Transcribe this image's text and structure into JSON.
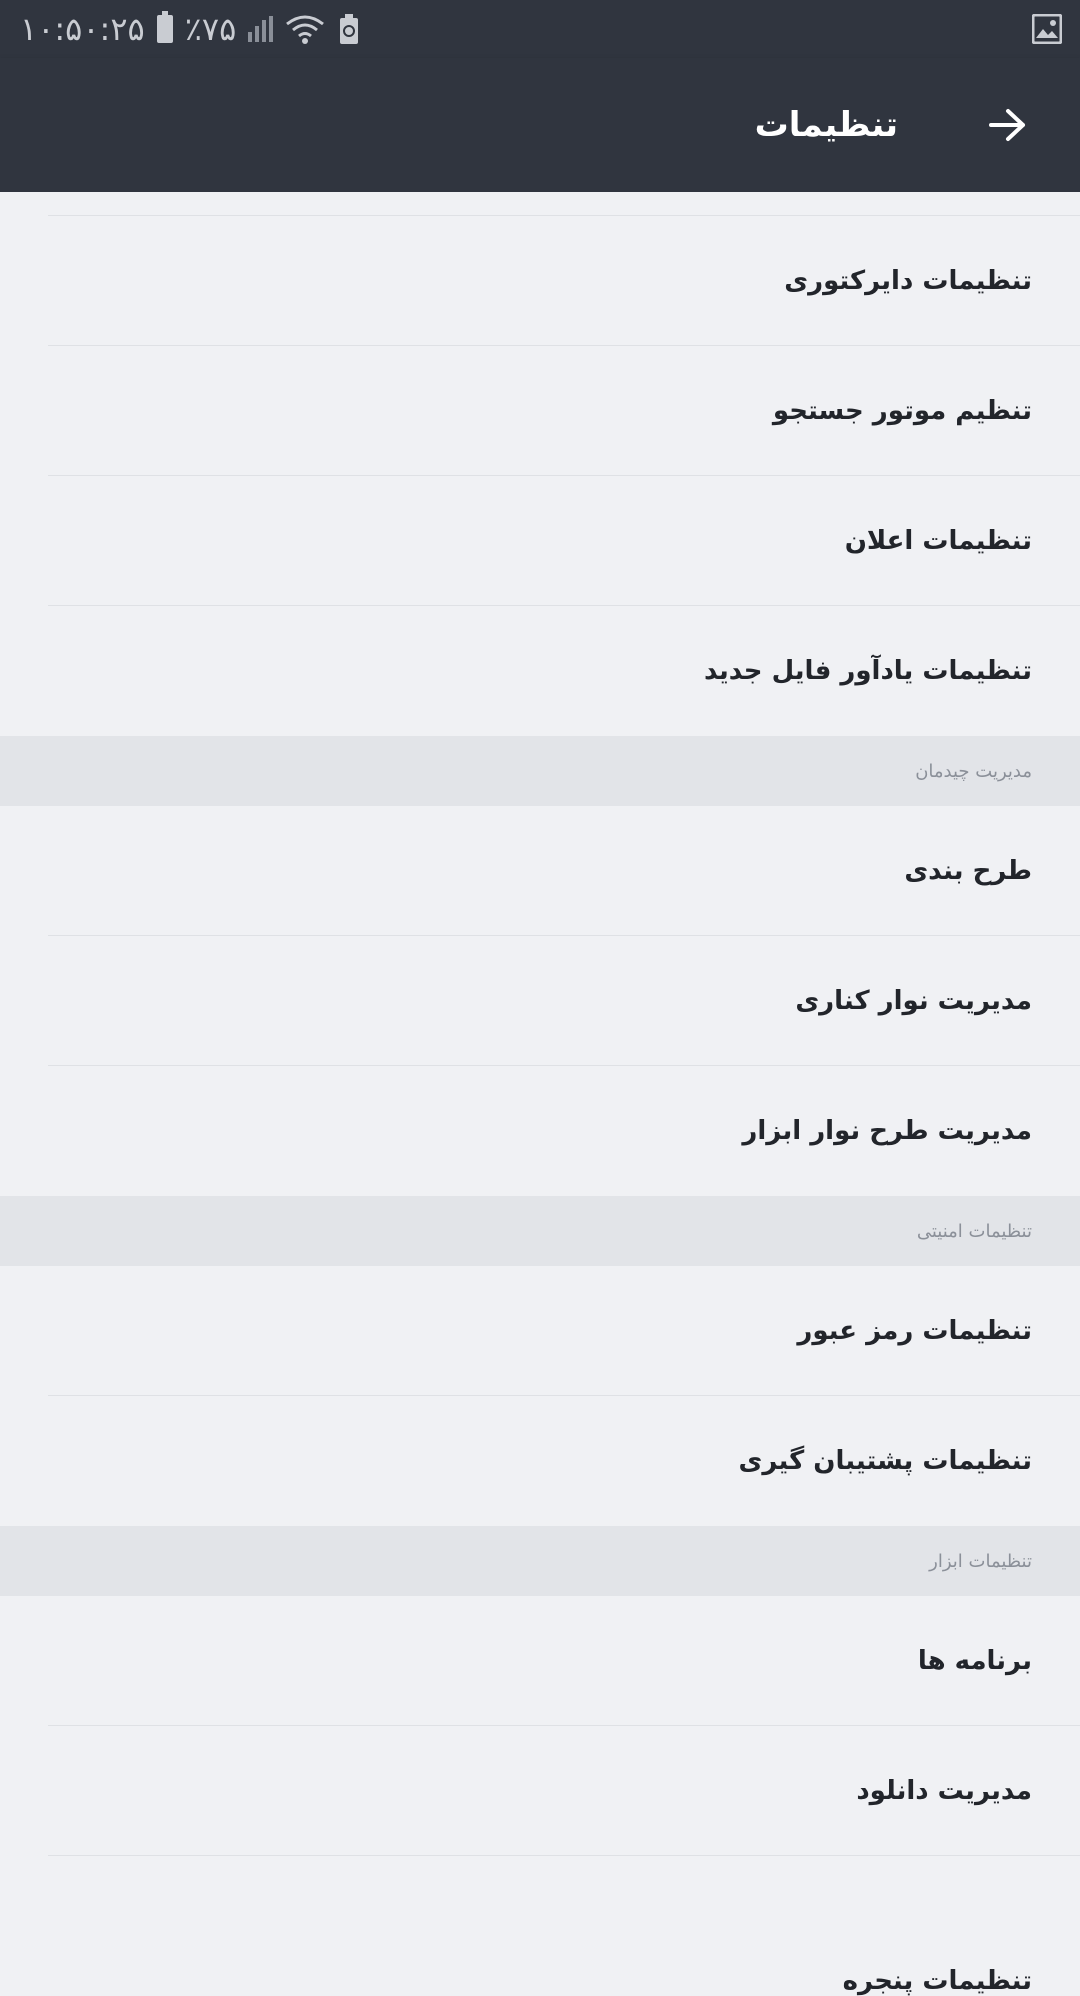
{
  "status_bar": {
    "clock": "۱۰:۵۰:۲۵",
    "battery": "٪۷۵"
  },
  "toolbar": {
    "title": "تنظیمات"
  },
  "items": {
    "directory": "تنظیمات دایرکتوری",
    "search_engine": "تنظیم موتور جستجو",
    "notifications": "تنظیمات اعلان",
    "new_file_reminder": "تنظیمات یادآور فایل جدید",
    "layout": "طرح بندی",
    "sidebar": "مدیریت نوار کناری",
    "toolbar_layout": "مدیریت طرح نوار ابزار",
    "password": "تنظیمات رمز عبور",
    "backup": "تنظیمات پشتیبان گیری",
    "apps": "برنامه ها",
    "downloads": "مدیریت دانلود",
    "window_partial": "تنظیمات پنجره"
  },
  "sections": {
    "layout_management": "مدیریت چیدمان",
    "security": "تنظیمات امنیتی",
    "tools": "تنظیمات ابزار"
  }
}
